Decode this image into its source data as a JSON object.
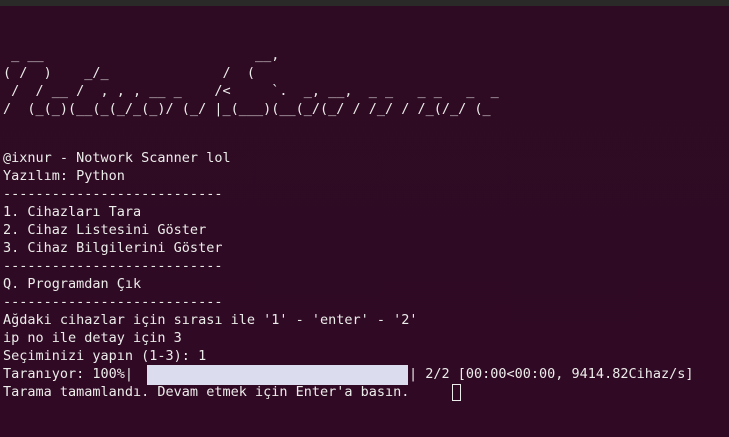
{
  "terminal": {
    "banner": [
      " _ __                          __,",
      "( /  )    _/_              /  (",
      " /  / __ /  , , , __ _    /<     `.  _, __,  _ _   _ _   _  _",
      "/  (_(_)(__(_(_/_(_)/ (_/ |_(___)(__(_/(_/ / /_/ / /_(/_/ (_"
    ],
    "lines": [
      "@ixnur - Notwork Scanner lol",
      "Yazılım: Python",
      "---------------------------",
      "1. Cihazları Tara",
      "2. Cihaz Listesini Göster",
      "3. Cihaz Bilgilerini Göster",
      "---------------------------",
      "Q. Programdan Çık",
      "---------------------------",
      "Ağdaki cihazlar için sırası ile '1' - 'enter' - '2'",
      "ip no ile detay için 3",
      "Seçiminizi yapın (1-3): 1"
    ],
    "progress": {
      "prefix": "Taranıyor: 100%|",
      "value": 1.0,
      "suffix": "| 2/2 [00:00<00:00, 9414.82Cihaz/s]"
    },
    "final_line": "Tarama tamamlandı. Devam etmek için Enter'a basın."
  },
  "colors": {
    "background": "#300a24",
    "text": "#ececea",
    "progress_fill": "#dcdcef"
  }
}
